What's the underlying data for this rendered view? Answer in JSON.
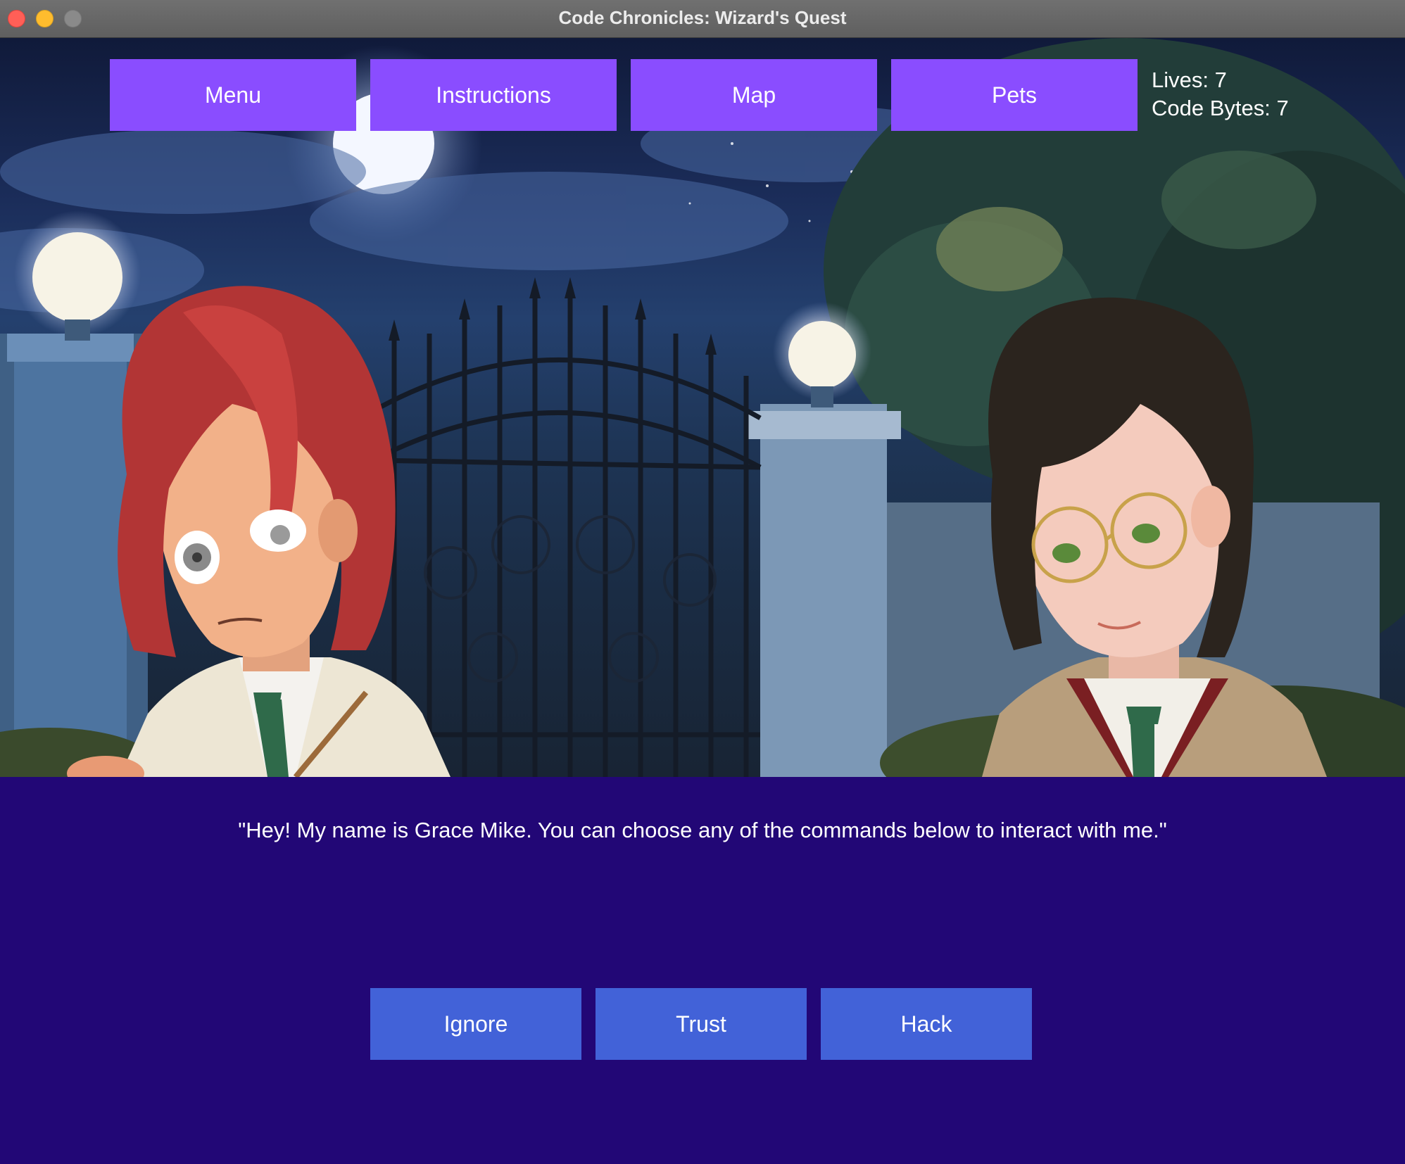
{
  "window": {
    "title": "Code Chronicles: Wizard's Quest"
  },
  "nav": {
    "menu_label": "Menu",
    "instructions_label": "Instructions",
    "map_label": "Map",
    "pets_label": "Pets"
  },
  "stats": {
    "lives_text": "Lives: 7",
    "code_bytes_text": "Code Bytes: 7"
  },
  "dialog": {
    "text": "\"Hey! My name is Grace Mike. You can choose any of the commands below to interact with me.\""
  },
  "choices": {
    "ignore_label": "Ignore",
    "trust_label": "Trust",
    "hack_label": "Hack"
  },
  "colors": {
    "nav_button": "#8a4dff",
    "choice_button": "#4262d8",
    "dialog_panel": "#220776"
  }
}
